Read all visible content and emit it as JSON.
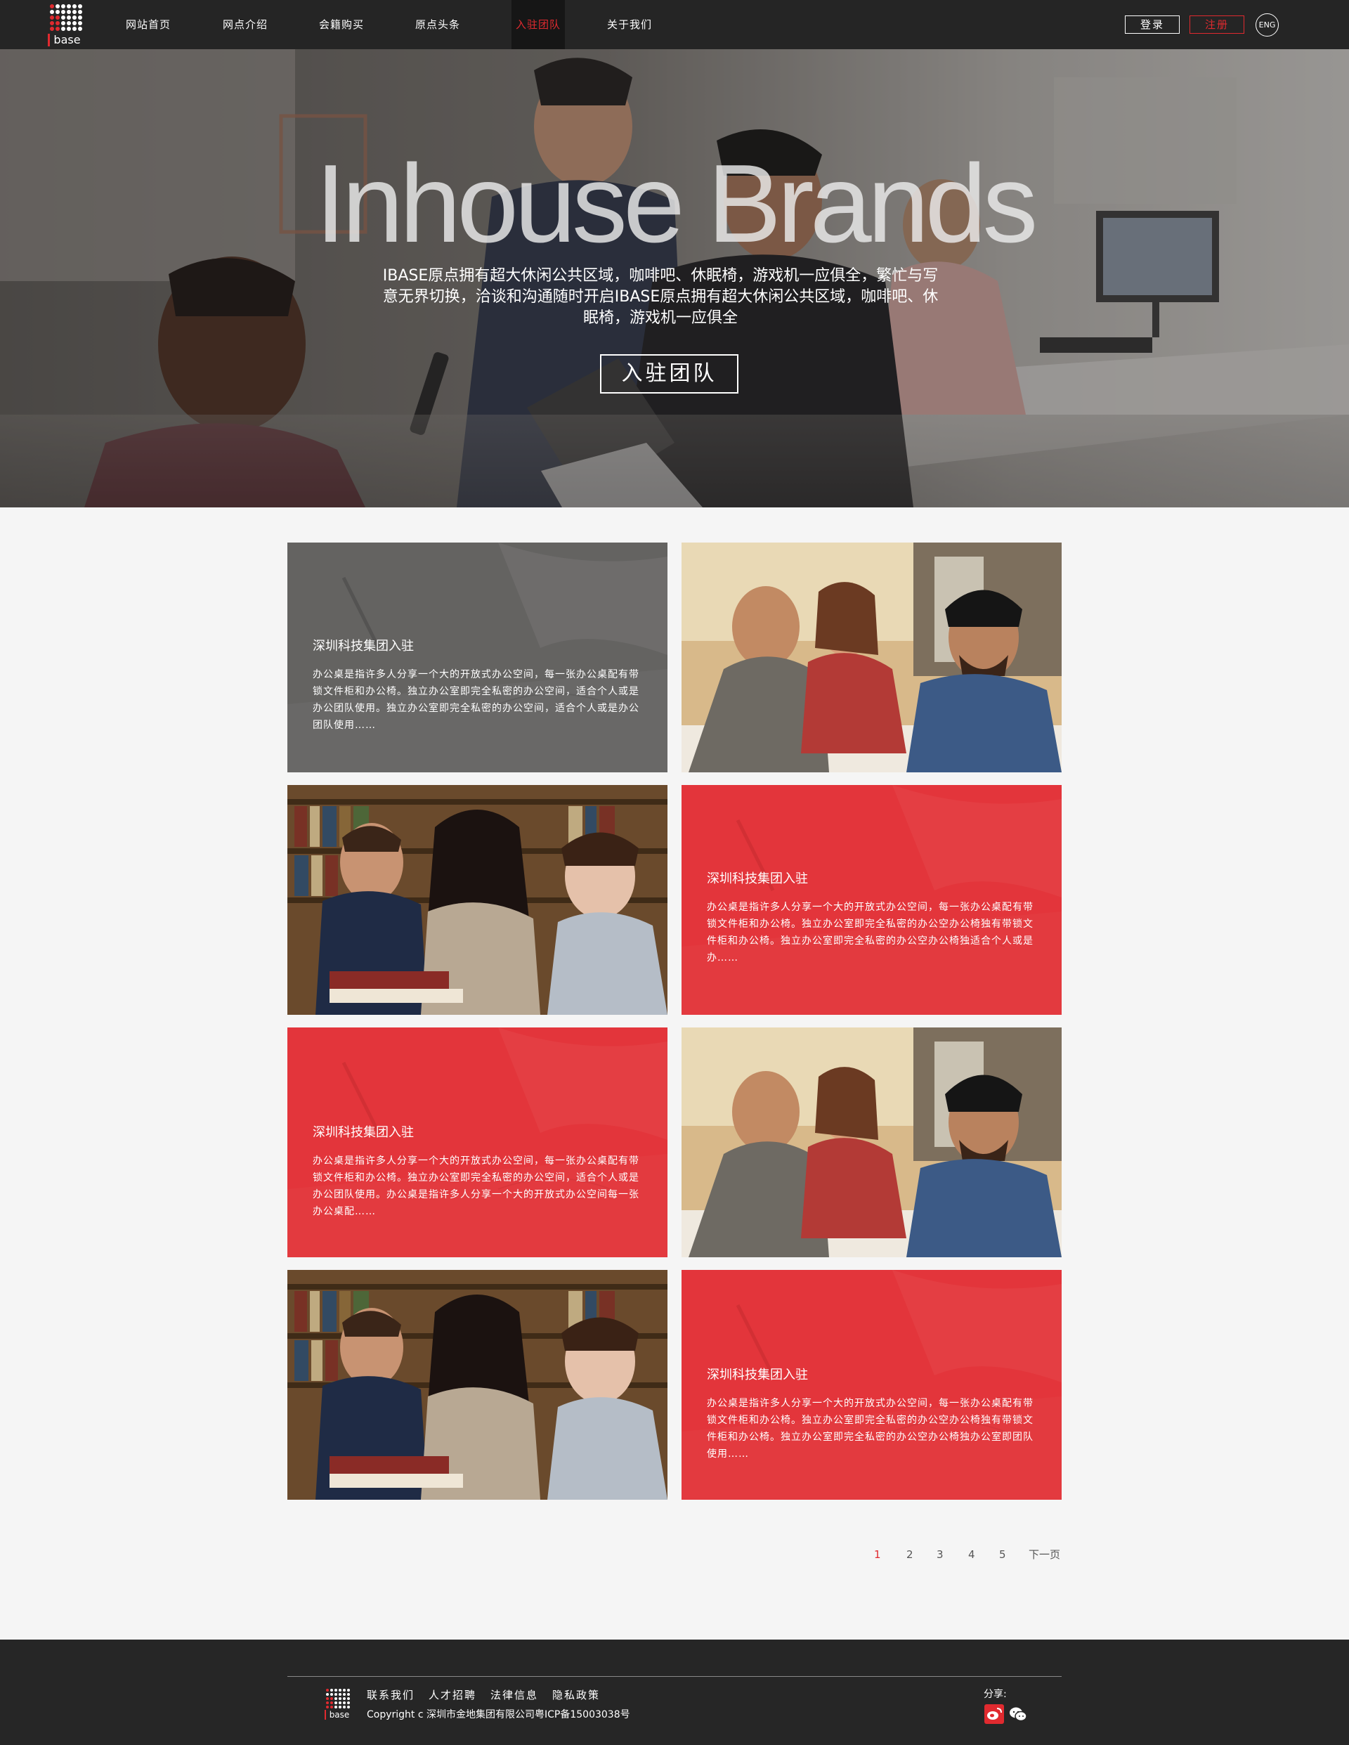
{
  "nav": {
    "logo_text": "base",
    "items": [
      {
        "label": "网站首页"
      },
      {
        "label": "网点介绍"
      },
      {
        "label": "会籍购买"
      },
      {
        "label": "原点头条"
      },
      {
        "label": "入驻团队"
      },
      {
        "label": "关于我们"
      }
    ],
    "active_index": 4,
    "login_label": "登录",
    "register_label": "注册",
    "lang_label": "ENG"
  },
  "hero": {
    "title": "Inhouse Brands",
    "text": "IBASE原点拥有超大休闲公共区域，咖啡吧、休眠椅，游戏机一应俱全，繁忙与写意无界切换，洽谈和沟通随时开启IBASE原点拥有超大休闲公共区域，咖啡吧、休眠椅，游戏机一应俱全",
    "button_label": "入驻团队"
  },
  "tiles": [
    {
      "kind": "gray",
      "title": "深圳科技集团入驻",
      "body": "办公桌是指许多人分享一个大的开放式办公空间，每一张办公桌配有带锁文件柜和办公椅。独立办公室即完全私密的办公空间，适合个人或是办公团队使用。独立办公室即完全私密的办公空间，适合个人或是办公团队使用……"
    },
    {
      "kind": "photo-group",
      "title": "",
      "body": ""
    },
    {
      "kind": "photo-library",
      "title": "",
      "body": ""
    },
    {
      "kind": "red",
      "title": "深圳科技集团入驻",
      "body": "办公桌是指许多人分享一个大的开放式办公空间，每一张办公桌配有带锁文件柜和办公椅。独立办公室即完全私密的办公空办公椅独有带锁文件柜和办公椅。独立办公室即完全私密的办公空办公椅独适合个人或是办……"
    },
    {
      "kind": "red",
      "title": "深圳科技集团入驻",
      "body": "办公桌是指许多人分享一个大的开放式办公空间，每一张办公桌配有带锁文件柜和办公椅。独立办公室即完全私密的办公空间，适合个人或是办公团队使用。办公桌是指许多人分享一个大的开放式办公空间每一张办公桌配……"
    },
    {
      "kind": "photo-group",
      "title": "",
      "body": ""
    },
    {
      "kind": "photo-library",
      "title": "",
      "body": ""
    },
    {
      "kind": "red",
      "title": "深圳科技集团入驻",
      "body": "办公桌是指许多人分享一个大的开放式办公空间，每一张办公桌配有带锁文件柜和办公椅。独立办公室即完全私密的办公空办公椅独有带锁文件柜和办公椅。独立办公室即完全私密的办公空办公椅独办公室即团队使用……"
    }
  ],
  "pagination": {
    "pages": [
      "1",
      "2",
      "3",
      "4",
      "5"
    ],
    "current": "1",
    "next_label": "下一页"
  },
  "footer": {
    "logo_text": "base",
    "links": [
      "联系我们",
      "人才招聘",
      "法律信息",
      "隐私政策"
    ],
    "copyright": "Copyright c 深圳市金地集团有限公司粤ICP备15003038号",
    "share_label": "分享:",
    "share_icons": [
      "weibo-icon",
      "wechat-icon"
    ]
  },
  "colors": {
    "accent": "#e02a2f",
    "nav_bg": "#252525",
    "footer_bg": "#262626",
    "page_bg": "#f5f5f5"
  }
}
